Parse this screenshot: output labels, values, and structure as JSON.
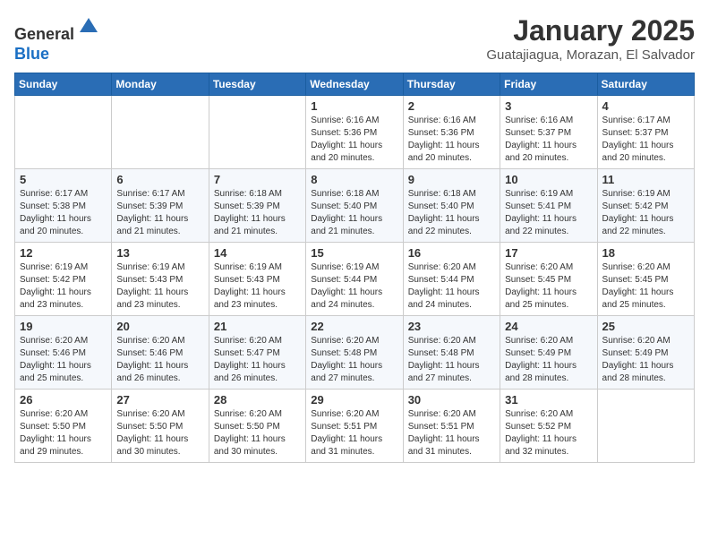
{
  "header": {
    "logo_line1": "General",
    "logo_line2": "Blue",
    "month": "January 2025",
    "location": "Guatajiagua, Morazan, El Salvador"
  },
  "weekdays": [
    "Sunday",
    "Monday",
    "Tuesday",
    "Wednesday",
    "Thursday",
    "Friday",
    "Saturday"
  ],
  "weeks": [
    [
      {
        "day": "",
        "info": ""
      },
      {
        "day": "",
        "info": ""
      },
      {
        "day": "",
        "info": ""
      },
      {
        "day": "1",
        "info": "Sunrise: 6:16 AM\nSunset: 5:36 PM\nDaylight: 11 hours\nand 20 minutes."
      },
      {
        "day": "2",
        "info": "Sunrise: 6:16 AM\nSunset: 5:36 PM\nDaylight: 11 hours\nand 20 minutes."
      },
      {
        "day": "3",
        "info": "Sunrise: 6:16 AM\nSunset: 5:37 PM\nDaylight: 11 hours\nand 20 minutes."
      },
      {
        "day": "4",
        "info": "Sunrise: 6:17 AM\nSunset: 5:37 PM\nDaylight: 11 hours\nand 20 minutes."
      }
    ],
    [
      {
        "day": "5",
        "info": "Sunrise: 6:17 AM\nSunset: 5:38 PM\nDaylight: 11 hours\nand 20 minutes."
      },
      {
        "day": "6",
        "info": "Sunrise: 6:17 AM\nSunset: 5:39 PM\nDaylight: 11 hours\nand 21 minutes."
      },
      {
        "day": "7",
        "info": "Sunrise: 6:18 AM\nSunset: 5:39 PM\nDaylight: 11 hours\nand 21 minutes."
      },
      {
        "day": "8",
        "info": "Sunrise: 6:18 AM\nSunset: 5:40 PM\nDaylight: 11 hours\nand 21 minutes."
      },
      {
        "day": "9",
        "info": "Sunrise: 6:18 AM\nSunset: 5:40 PM\nDaylight: 11 hours\nand 22 minutes."
      },
      {
        "day": "10",
        "info": "Sunrise: 6:19 AM\nSunset: 5:41 PM\nDaylight: 11 hours\nand 22 minutes."
      },
      {
        "day": "11",
        "info": "Sunrise: 6:19 AM\nSunset: 5:42 PM\nDaylight: 11 hours\nand 22 minutes."
      }
    ],
    [
      {
        "day": "12",
        "info": "Sunrise: 6:19 AM\nSunset: 5:42 PM\nDaylight: 11 hours\nand 23 minutes."
      },
      {
        "day": "13",
        "info": "Sunrise: 6:19 AM\nSunset: 5:43 PM\nDaylight: 11 hours\nand 23 minutes."
      },
      {
        "day": "14",
        "info": "Sunrise: 6:19 AM\nSunset: 5:43 PM\nDaylight: 11 hours\nand 23 minutes."
      },
      {
        "day": "15",
        "info": "Sunrise: 6:19 AM\nSunset: 5:44 PM\nDaylight: 11 hours\nand 24 minutes."
      },
      {
        "day": "16",
        "info": "Sunrise: 6:20 AM\nSunset: 5:44 PM\nDaylight: 11 hours\nand 24 minutes."
      },
      {
        "day": "17",
        "info": "Sunrise: 6:20 AM\nSunset: 5:45 PM\nDaylight: 11 hours\nand 25 minutes."
      },
      {
        "day": "18",
        "info": "Sunrise: 6:20 AM\nSunset: 5:45 PM\nDaylight: 11 hours\nand 25 minutes."
      }
    ],
    [
      {
        "day": "19",
        "info": "Sunrise: 6:20 AM\nSunset: 5:46 PM\nDaylight: 11 hours\nand 25 minutes."
      },
      {
        "day": "20",
        "info": "Sunrise: 6:20 AM\nSunset: 5:46 PM\nDaylight: 11 hours\nand 26 minutes."
      },
      {
        "day": "21",
        "info": "Sunrise: 6:20 AM\nSunset: 5:47 PM\nDaylight: 11 hours\nand 26 minutes."
      },
      {
        "day": "22",
        "info": "Sunrise: 6:20 AM\nSunset: 5:48 PM\nDaylight: 11 hours\nand 27 minutes."
      },
      {
        "day": "23",
        "info": "Sunrise: 6:20 AM\nSunset: 5:48 PM\nDaylight: 11 hours\nand 27 minutes."
      },
      {
        "day": "24",
        "info": "Sunrise: 6:20 AM\nSunset: 5:49 PM\nDaylight: 11 hours\nand 28 minutes."
      },
      {
        "day": "25",
        "info": "Sunrise: 6:20 AM\nSunset: 5:49 PM\nDaylight: 11 hours\nand 28 minutes."
      }
    ],
    [
      {
        "day": "26",
        "info": "Sunrise: 6:20 AM\nSunset: 5:50 PM\nDaylight: 11 hours\nand 29 minutes."
      },
      {
        "day": "27",
        "info": "Sunrise: 6:20 AM\nSunset: 5:50 PM\nDaylight: 11 hours\nand 30 minutes."
      },
      {
        "day": "28",
        "info": "Sunrise: 6:20 AM\nSunset: 5:50 PM\nDaylight: 11 hours\nand 30 minutes."
      },
      {
        "day": "29",
        "info": "Sunrise: 6:20 AM\nSunset: 5:51 PM\nDaylight: 11 hours\nand 31 minutes."
      },
      {
        "day": "30",
        "info": "Sunrise: 6:20 AM\nSunset: 5:51 PM\nDaylight: 11 hours\nand 31 minutes."
      },
      {
        "day": "31",
        "info": "Sunrise: 6:20 AM\nSunset: 5:52 PM\nDaylight: 11 hours\nand 32 minutes."
      },
      {
        "day": "",
        "info": ""
      }
    ]
  ]
}
